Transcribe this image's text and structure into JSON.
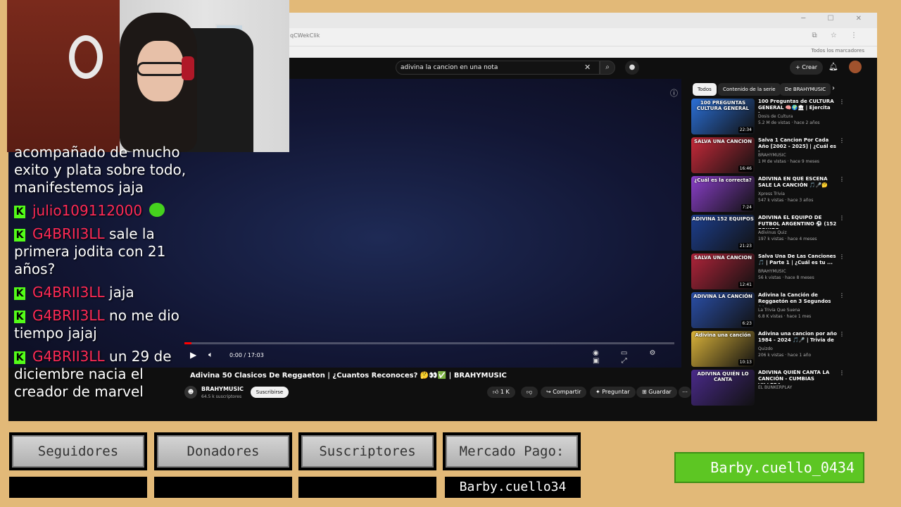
{
  "browser": {
    "url": "qCWekClik",
    "bookmarks_label": "Todos los marcadores"
  },
  "youtube": {
    "search_query": "adivina la cancion en una nota",
    "create_label": "Crear",
    "player": {
      "time": "0:00 / 17:03",
      "progress_fraction": 0.014
    },
    "video": {
      "title": "Adivina 50 Clasicos De Reggaeton | ¿Cuantos Reconoces? 🤔👀✅ | BRAHYMUSIC",
      "channel": "BRAHYMUSIC",
      "subscribers": "64.5 k suscriptores",
      "subscribe_label": "Suscribirse",
      "likes": "1 K",
      "share_label": "Compartir",
      "ask_label": "Preguntar",
      "save_label": "Guardar"
    },
    "chips": [
      "Todos",
      "Contenido de la serie",
      "De BRAHYMUSIC"
    ],
    "recommendations": [
      {
        "thumb_text": "100 PREGUNTAS CULTURA GENERAL",
        "title": "100 Preguntas de CULTURA GENERAL 🧠🌍🏛 | Ejercita t...",
        "channel": "Dosis de Cultura",
        "views": "5.2 M de vistas · hace 2 años",
        "duration": "22:34",
        "color": "#2b6fd6"
      },
      {
        "thumb_text": "SALVA UNA CANCION",
        "title": "Salva 1 Cancion Por Cada Año [2002 - 2025] | ¿Cuál es tu ...",
        "channel": "BRAHYMUSIC",
        "views": "1 M de vistas · hace 9 meses",
        "duration": "16:46",
        "color": "#c72a3a"
      },
      {
        "thumb_text": "¿Cuál es la correcta?",
        "title": "ADIVINA EN QUÉ ESCENA SALE LA CANCIÓN 🎵🎤🤔",
        "channel": "Xpress Trivia",
        "views": "547 k vistas · hace 3 años",
        "duration": "7:24",
        "color": "#8a3fc9"
      },
      {
        "thumb_text": "ADIVINA 152 EQUIPOS",
        "title": "ADIVINA EL EQUIPO DE FUTBOL ARGENTINO ⚽ (152 EQUIPO...",
        "channel": "Adivinus Quiz",
        "views": "197 k vistas · hace 4 meses",
        "duration": "21:23",
        "color": "#1d3f8f"
      },
      {
        "thumb_text": "SALVA UNA CANCION",
        "title": "Salva Una De Las Canciones 🎵 | Parte 1 | ¿Cuál es tu ...",
        "channel": "BRAHYMUSIC",
        "views": "56 k vistas · hace 8 meses",
        "duration": "12:41",
        "color": "#b0243a"
      },
      {
        "thumb_text": "ADIVINA LA CANCIÓN",
        "title": "Adivina la Canción de Reggaetón en 3 Segundos 🎶...",
        "channel": "La Trivia Que Suena",
        "views": "6.8 K vistas · hace 1 mes",
        "duration": "6:23",
        "color": "#2a4fa8"
      },
      {
        "thumb_text": "Adivina una canción",
        "title": "Adivina una cancion por año 1984 - 2024 🎵🎤 | Trivia de ...",
        "channel": "Quizdo",
        "views": "206 k vistas · hace 1 año",
        "duration": "10:13",
        "color": "#d9b23a"
      },
      {
        "thumb_text": "ADIVINA QUIÉN LO CANTA",
        "title": "ADIVINA QUIÉN CANTA LA CANCIÓN - CUMBIAS VILLERA...",
        "channel": "EL BUNKERPLAY",
        "views": "",
        "duration": "",
        "color": "#4a2a8a"
      }
    ]
  },
  "chat": [
    {
      "type": "continuation",
      "text": "acompañado de mucho exito y plata sobre todo, manifestemos jaja"
    },
    {
      "type": "msg",
      "user": "julio109112000",
      "text": "",
      "emote": true
    },
    {
      "type": "msg",
      "user": "G4BRII3LL",
      "text": "sale la primera jodita con 21 años?"
    },
    {
      "type": "msg",
      "user": "G4BRII3LL",
      "text": "jaja"
    },
    {
      "type": "msg",
      "user": "G4BRII3LL",
      "text": "no me dio tiempo jajaj"
    },
    {
      "type": "msg",
      "user": "G4BRII3LL",
      "text": "un 29 de diciembre nacia el creador de marvel"
    }
  ],
  "panels": {
    "seguidores": "Seguidores",
    "donadores": "Donadores",
    "suscriptores": "Suscriptores",
    "mercado_pago": "Mercado Pago:",
    "mercado_pago_value": "Barby.cuello34",
    "handle": "Barby.cuello_0434"
  }
}
